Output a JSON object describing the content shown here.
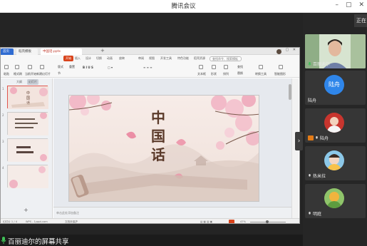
{
  "window": {
    "title": "腾讯会议",
    "controls": [
      "–",
      "▢",
      "✕"
    ]
  },
  "right_panel": {
    "speaking_label": "正在",
    "participants": [
      {
        "name": "百丽迪尔",
        "video": true
      },
      {
        "name": "陆舟",
        "avatar_text": "陆舟"
      },
      {
        "name": "陆舟",
        "host": true
      },
      {
        "name": "热米拉"
      },
      {
        "name": "明庭"
      }
    ]
  },
  "sharer": {
    "text": "百丽迪尔的屏幕共享"
  },
  "wps": {
    "tabs": {
      "home": "首页",
      "shell": "稻壳模板",
      "doc": "中国话.pptx"
    },
    "menu": [
      "开始",
      "插入",
      "设计",
      "切换",
      "动画",
      "放映",
      "审阅",
      "视图",
      "开发工具",
      "特色功能",
      "稻壳资源"
    ],
    "search": "查找命令、搜索模板",
    "toolbar_items": [
      "粘贴",
      "格式刷",
      "当前开始",
      "新建幻灯片",
      "版式",
      "节",
      "重置",
      "文本框",
      "形状",
      "排列",
      "查找",
      "替换",
      "选择",
      "转换工具",
      "智能图形"
    ],
    "thumbs_header": {
      "outline": "大纲",
      "slides": "幻灯片"
    },
    "slides": [
      {
        "num": "1"
      },
      {
        "num": "2"
      },
      {
        "num": "3"
      },
      {
        "num": "4"
      }
    ],
    "slide_title": "中国话",
    "notes_placeholder": "单击此处添加备注",
    "status": {
      "slide_info": "幻灯片 1 / 4",
      "theme": "WPS - 1yppt.com",
      "protect": "文档未保护",
      "zoom": "47%"
    }
  }
}
